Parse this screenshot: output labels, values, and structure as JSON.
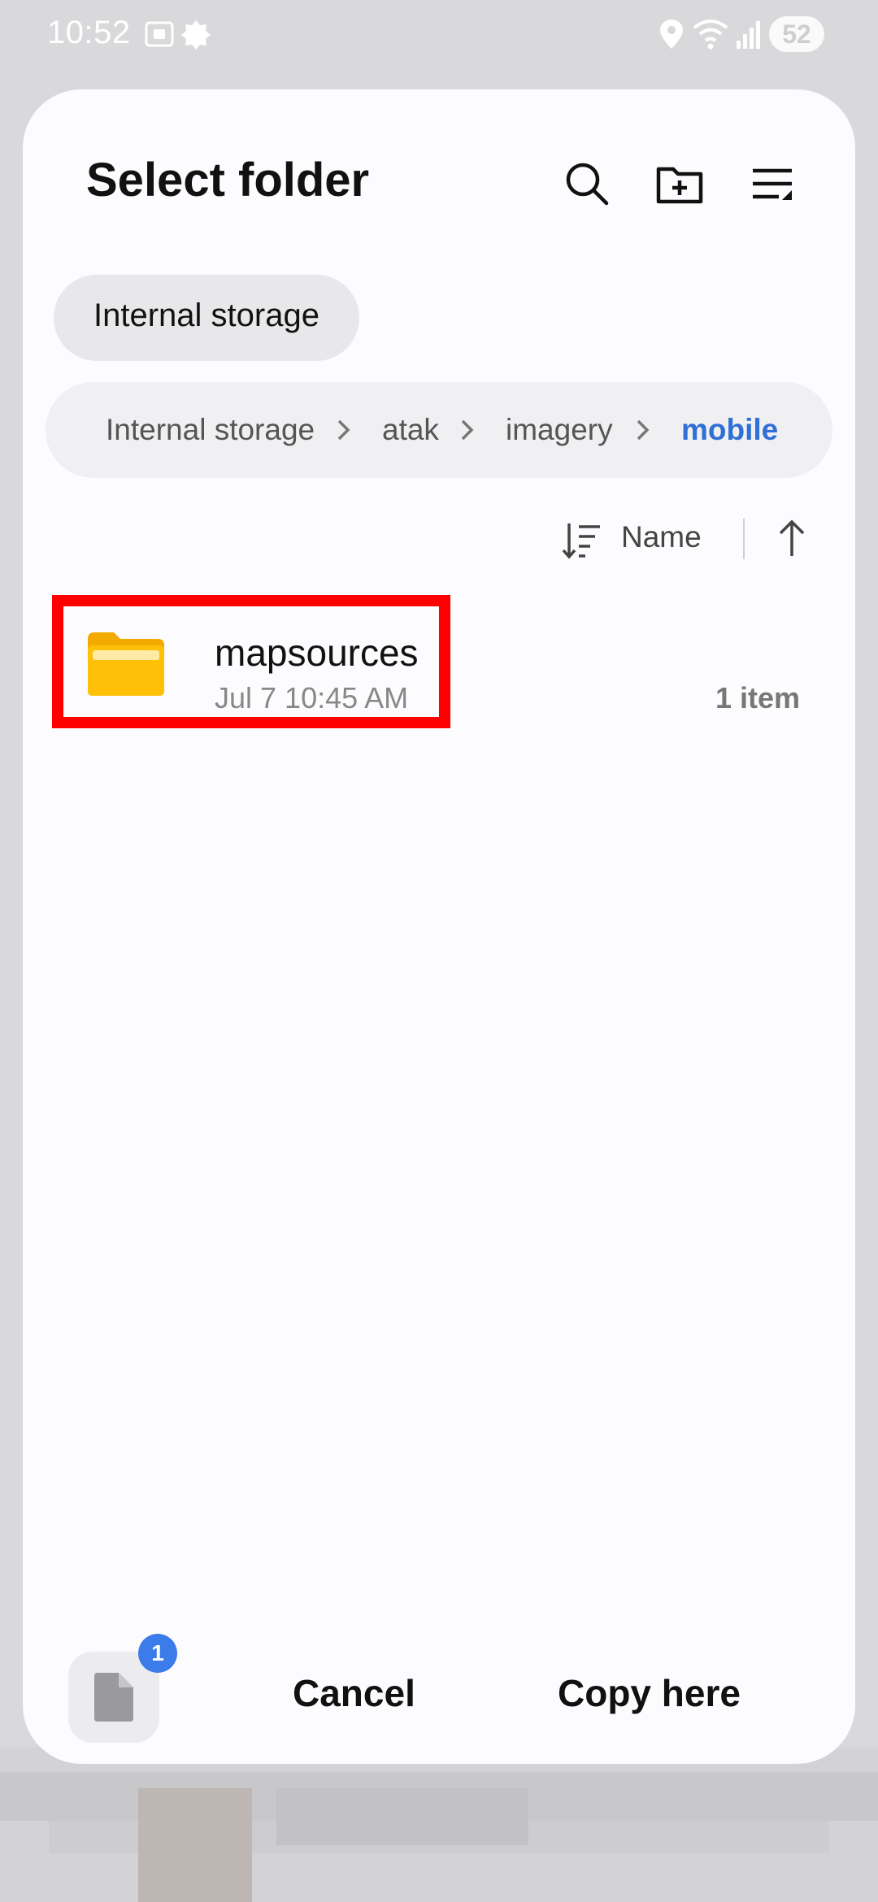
{
  "status_bar": {
    "time": "10:52",
    "battery": "52",
    "icons": [
      "screenshot-icon",
      "notification-gear-icon",
      "location-icon",
      "wifi-icon",
      "signal-icon"
    ]
  },
  "dialog": {
    "title": "Select folder",
    "actions": [
      "search-icon",
      "new-folder-icon",
      "list-view-icon"
    ],
    "storage_chip": "Internal storage",
    "breadcrumb": [
      "Internal storage",
      "atak",
      "imagery",
      "mobile"
    ],
    "sort": {
      "label": "Name",
      "direction": "ascending"
    },
    "folders": [
      {
        "name": "mapsources",
        "date": "Jul 7 10:45 AM",
        "count": "1 item",
        "highlighted": true
      }
    ],
    "bottom": {
      "clipboard_badge": "1",
      "cancel_label": "Cancel",
      "copy_label": "Copy here"
    }
  },
  "colors": {
    "accent": "#2f6fd6",
    "highlight_box": "#ff0000",
    "folder": "#ffc107",
    "badge": "#3b7bea"
  }
}
